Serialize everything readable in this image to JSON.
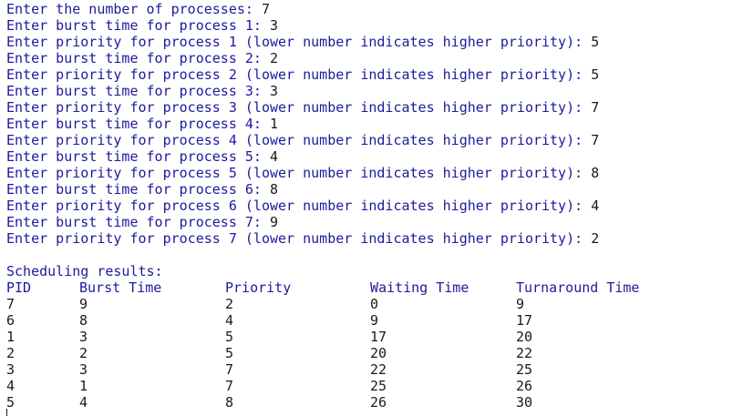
{
  "console": {
    "input_lines": [
      {
        "prompt": "Enter the number of processes: ",
        "value": "7"
      },
      {
        "prompt": "Enter burst time for process 1: ",
        "value": "3"
      },
      {
        "prompt": "Enter priority for process 1 (lower number indicates higher priority): ",
        "value": "5"
      },
      {
        "prompt": "Enter burst time for process 2: ",
        "value": "2"
      },
      {
        "prompt": "Enter priority for process 2 (lower number indicates higher priority): ",
        "value": "5"
      },
      {
        "prompt": "Enter burst time for process 3: ",
        "value": "3"
      },
      {
        "prompt": "Enter priority for process 3 (lower number indicates higher priority): ",
        "value": "7"
      },
      {
        "prompt": "Enter burst time for process 4: ",
        "value": "1"
      },
      {
        "prompt": "Enter priority for process 4 (lower number indicates higher priority): ",
        "value": "7"
      },
      {
        "prompt": "Enter burst time for process 5: ",
        "value": "4"
      },
      {
        "prompt": "Enter priority for process 5 (lower number indicates higher priority): ",
        "value": "8"
      },
      {
        "prompt": "Enter burst time for process 6: ",
        "value": "8"
      },
      {
        "prompt": "Enter priority for process 6 (lower number indicates higher priority): ",
        "value": "4"
      },
      {
        "prompt": "Enter burst time for process 7: ",
        "value": "9"
      },
      {
        "prompt": "Enter priority for process 7 (lower number indicates higher priority): ",
        "value": "2"
      }
    ],
    "results_title": "Scheduling results:",
    "table": {
      "headers": [
        "PID",
        "Burst Time",
        "Priority",
        "Waiting Time",
        "Turnaround Time"
      ],
      "rows": [
        [
          "7",
          "9",
          "2",
          "0",
          "9"
        ],
        [
          "6",
          "8",
          "4",
          "9",
          "17"
        ],
        [
          "1",
          "3",
          "5",
          "17",
          "20"
        ],
        [
          "2",
          "2",
          "5",
          "20",
          "22"
        ],
        [
          "3",
          "3",
          "7",
          "22",
          "25"
        ],
        [
          "4",
          "1",
          "7",
          "25",
          "26"
        ],
        [
          "5",
          "4",
          "8",
          "26",
          "30"
        ]
      ]
    }
  },
  "colors": {
    "prompt_text": "#1b1b9c",
    "value_text": "#1a1a1a",
    "background": "#ffffff"
  }
}
